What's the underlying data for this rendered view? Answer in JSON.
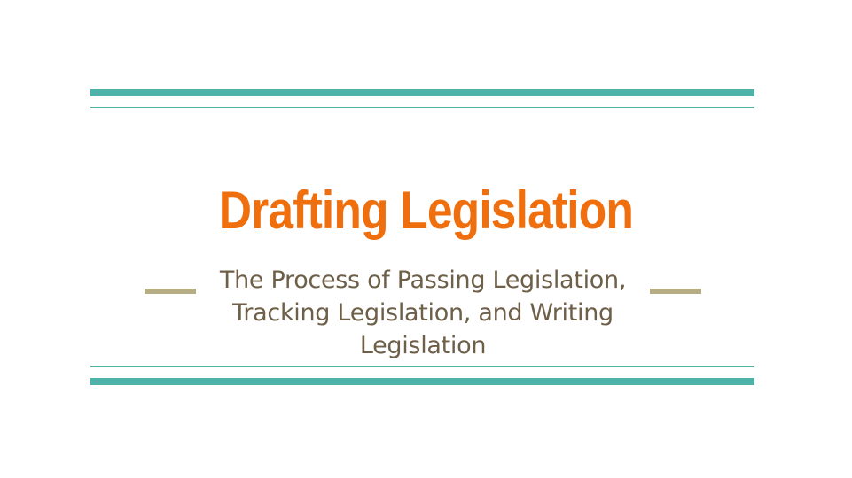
{
  "slide": {
    "title": "Drafting Legislation",
    "subtitle": "The Process of Passing Legislation, Tracking Legislation, and Writing Legislation"
  },
  "colors": {
    "accent_teal": "#4db3a8",
    "title_orange": "#ef6f0e",
    "subtitle_brown": "#6e5f48",
    "dash_tan": "#b7ad84"
  }
}
